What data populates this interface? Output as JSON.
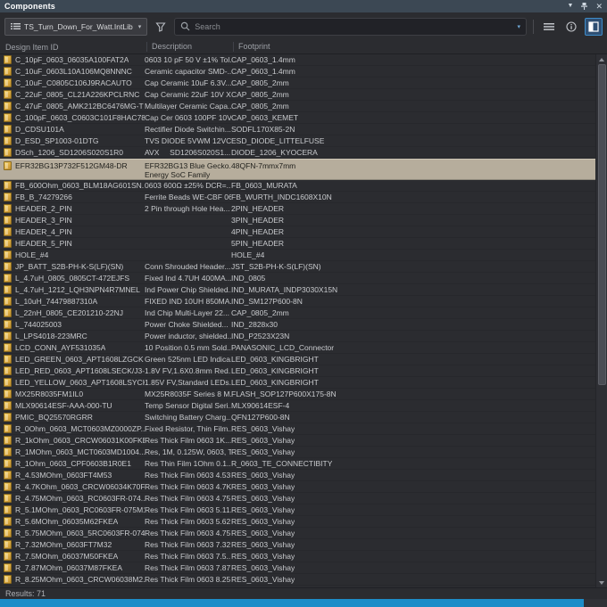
{
  "titlebar": {
    "title": "Components"
  },
  "icons": {
    "caret_down": "▾",
    "chevron_down": "▼",
    "close": "✕"
  },
  "toolbar": {
    "library": "TS_Turn_Down_For_Watt.IntLib",
    "search_placeholder": "Search"
  },
  "table": {
    "columns": [
      {
        "label": "Design Item ID"
      },
      {
        "label": "Description"
      },
      {
        "label": "Footprint"
      }
    ],
    "rows": [
      {
        "id": "C_10pF_0603_06035A100FAT2A",
        "desc": "0603 10 pF 50 V ±1% Tol...",
        "fp": "CAP_0603_1.4mm"
      },
      {
        "id": "C_10uF_0603L10A106MQ8NNNC",
        "desc": "Ceramic capacitor SMD-...",
        "fp": "CAP_0603_1.4mm"
      },
      {
        "id": "C_10uF_C0805C106J9RACAUTO",
        "desc": "Cap Ceramic 10uF 6.3V...",
        "fp": "CAP_0805_2mm"
      },
      {
        "id": "C_22uF_0805_CL21A226KPCLRNC",
        "desc": "Cap Ceramic 22uF 10V X...",
        "fp": "CAP_0805_2mm"
      },
      {
        "id": "C_47uF_0805_AMK212BC6476MG-T",
        "desc": "Multilayer Ceramic Capa...",
        "fp": "CAP_0805_2mm"
      },
      {
        "id": "C_100pF_0603_C0603C101F8HAC78...",
        "desc": "Cap Cer 0603 100PF 10V...",
        "fp": "CAP_0603_KEMET"
      },
      {
        "id": "D_CDSU101A",
        "desc": "Rectifier Diode Switchin...",
        "fp": "SODFL170X85-2N"
      },
      {
        "id": "D_ESD_SP1003-01DTG",
        "desc": "TVS DIODE 5VWM 12VC...",
        "fp": "ESD_DIODE_LITTELFUSE"
      },
      {
        "id": "DSch_1206_SD1206S020S1R0",
        "desc": "AVX     SD1206S020S1...",
        "fp": "DIODE_1206_KYOCERA"
      },
      {
        "id": "EFR32BG13P732F512GM48-DR",
        "desc": "EFR32BG13 Blue Gecko...",
        "desc2": "Energy SoC Family",
        "fp": "48QFN-7mmx7mm",
        "selected": true
      },
      {
        "id": "FB_600Ohm_0603_BLM18AG601SN...",
        "desc": "0603 600Ω ±25% DCR=...",
        "fp": "FB_0603_MURATA"
      },
      {
        "id": "FB_B_74279266",
        "desc": "Ferrite Beads WE-CBF 06...",
        "fp": "FB_WURTH_INDC1608X10N"
      },
      {
        "id": "HEADER_2_PIN",
        "desc": "2 Pin through Hole Hea...",
        "fp": "2PIN_HEADER"
      },
      {
        "id": "HEADER_3_PIN",
        "desc": "",
        "fp": "3PIN_HEADER"
      },
      {
        "id": "HEADER_4_PIN",
        "desc": "",
        "fp": "4PIN_HEADER"
      },
      {
        "id": "HEADER_5_PIN",
        "desc": "",
        "fp": "5PIN_HEADER"
      },
      {
        "id": "HOLE_#4",
        "desc": "",
        "fp": "HOLE_#4"
      },
      {
        "id": "JP_BATT_S2B-PH-K-S(LF)(SN)",
        "desc": "Conn Shrouded Header...",
        "fp": "JST_S2B-PH-K-S(LF)(SN)"
      },
      {
        "id": "L_4.7uH_0805_0805CT-472EJFS",
        "desc": "Fixed Ind 4.7UH 400MA...",
        "fp": "IND_0805"
      },
      {
        "id": "L_4.7uH_1212_LQH3NPN4R7MNEL",
        "desc": "Ind Power Chip Shielded...",
        "fp": "IND_MURATA_INDP3030X15N"
      },
      {
        "id": "L_10uH_74479887310A",
        "desc": "FIXED IND 10UH 850MA...",
        "fp": "IND_SM127P600-8N"
      },
      {
        "id": "L_22nH_0805_CE201210-22NJ",
        "desc": "Ind Chip Multi-Layer 22...",
        "fp": "CAP_0805_2mm"
      },
      {
        "id": "L_744025003",
        "desc": "Power Choke Shielded...",
        "fp": "IND_2828x30"
      },
      {
        "id": "L_LPS4018-223MRC",
        "desc": "Power inductor, shielded...",
        "fp": "IND_P2523X23N"
      },
      {
        "id": "LCD_CONN_AYF531035A",
        "desc": "10 Position 0.5 mm Sold...",
        "fp": "PANASONIC_LCD_Connector"
      },
      {
        "id": "LED_GREEN_0603_APT1608LZGCK",
        "desc": "Green 525nm LED Indica...",
        "fp": "LED_0603_KINGBRIGHT"
      },
      {
        "id": "LED_RED_0603_APT1608LSECK/J3-P...",
        "desc": "1.8V FV,1.6X0.8mm Red...",
        "fp": "LED_0603_KINGBRIGHT"
      },
      {
        "id": "LED_YELLOW_0603_APT1608LSYCK/...",
        "desc": "1.85V FV,Standard LEDs...",
        "fp": "LED_0603_KINGBRIGHT"
      },
      {
        "id": "MX25R8035FM1IL0",
        "desc": "MX25R8035F Series 8 M...",
        "fp": "FLASH_SOP127P600X175-8N"
      },
      {
        "id": "MLX90614ESF-AAA-000-TU",
        "desc": "Temp Sensor Digital Seri...",
        "fp": "MLX90614ESF-4"
      },
      {
        "id": "PMIC_BQ25570RGRR",
        "desc": "Switching Battery Charg...",
        "fp": "QFN127P600-8N"
      },
      {
        "id": "R_0Ohm_0603_MCT0603MZ0000ZP...",
        "desc": "Fixed Resistor, Thin Film...",
        "fp": "RES_0603_Vishay"
      },
      {
        "id": "R_1kOhm_0603_CRCW06031K00FKE...",
        "desc": "Res Thick Film 0603 1K...",
        "fp": "RES_0603_Vishay"
      },
      {
        "id": "R_1MOhm_0603_MCT0603MD1004...",
        "desc": "Res, 1M, 0.125W, 0603, T...",
        "fp": "RES_0603_Vishay"
      },
      {
        "id": "R_1Ohm_0603_CPF0603B1R0E1",
        "desc": "Res Thin Film 1Ohm 0.1...",
        "fp": "R_0603_TE_CONNECTIBITY"
      },
      {
        "id": "R_4.53MOhm_0603FT4M53",
        "desc": "Res Thick Film 0603 4.53...",
        "fp": "RES_0603_Vishay"
      },
      {
        "id": "R_4.7KOhm_0603_CRCW06034K70F...",
        "desc": "Res Thick Film 0603 4.7K...",
        "fp": "RES_0603_Vishay"
      },
      {
        "id": "R_4.75MOhm_0603_RC0603FR-074...",
        "desc": "Res Thick Film 0603 4.75...",
        "fp": "RES_0603_Vishay"
      },
      {
        "id": "R_5.1MOhm_0603_RC0603FR-075M1L",
        "desc": "Res Thick Film 0603 5.11...",
        "fp": "RES_0603_Vishay"
      },
      {
        "id": "R_5.6MOhm_06035M62FKEA",
        "desc": "Res Thick Film 0603 5.62...",
        "fp": "RES_0603_Vishay"
      },
      {
        "id": "R_5.75MOhm_0603_5RC0603FR-074...",
        "desc": "Res Thick Film 0603 4.75...",
        "fp": "RES_0603_Vishay"
      },
      {
        "id": "R_7.32MOhm_0603FT7M32",
        "desc": "Res Thick Film 0603 7.32...",
        "fp": "RES_0603_Vishay"
      },
      {
        "id": "R_7.5MOhm_06037M50FKEA",
        "desc": "Res Thick Film 0603 7.5...",
        "fp": "RES_0603_Vishay"
      },
      {
        "id": "R_7.87MOhm_06037M87FKEA",
        "desc": "Res Thick Film 0603 7.87...",
        "fp": "RES_0603_Vishay"
      },
      {
        "id": "R_8.25MOhm_0603_CRCW06038M2...",
        "desc": "Res Thick Film 0603 8.25...",
        "fp": "RES_0603_Vishay"
      }
    ]
  },
  "statusbar": {
    "results": "Results: 71"
  },
  "colors": {
    "accent_blue": "#1d8dc8",
    "selection_bg": "#b6ad9c",
    "component_icon_yellow": "#e3b84d",
    "titlebar_bg": "#3c4854"
  }
}
